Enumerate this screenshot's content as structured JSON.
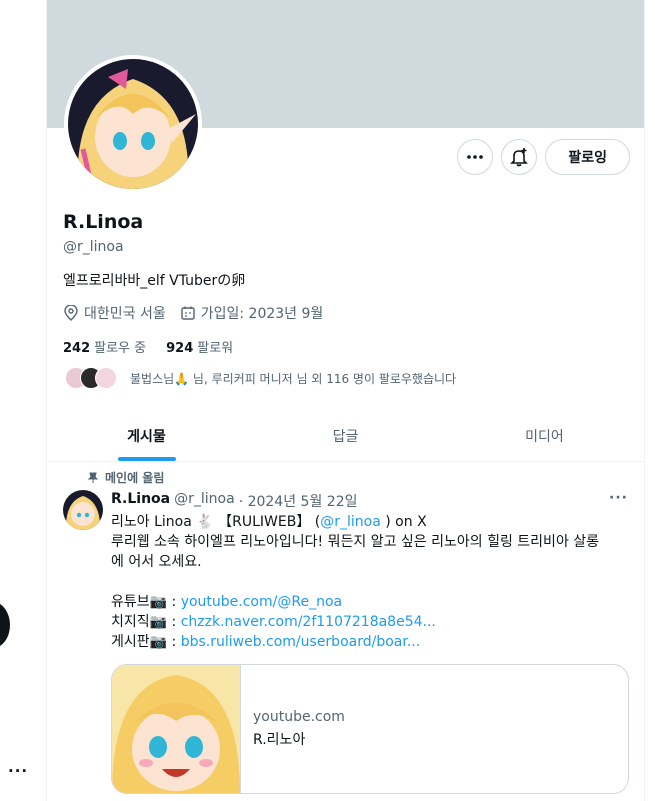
{
  "profile": {
    "name": "R.Linoa",
    "handle": "@r_linoa",
    "bio": "엘프로리바바_elf VTuberの卵",
    "location": "대한민국 서울",
    "joined": "가입일: 2023년 9월",
    "following_count": "242",
    "following_label": "팔로우 중",
    "followers_count": "924",
    "followers_label": "팔로워",
    "followed_by": "불법스님🙏 님, 루리커피 머니저 님 외 116 명이 팔로우했습니다",
    "follow_button": "팔로잉"
  },
  "tabs": [
    {
      "label": "게시물"
    },
    {
      "label": "답글"
    },
    {
      "label": "미디어"
    }
  ],
  "tweet": {
    "pinned_label": "메인에 올림",
    "author": "R.Linoa",
    "handle": "@r_linoa",
    "date": "· 2024년 5월 22일",
    "line1_a": "리노아 Linoa 🐇 【RULIWEB】 (",
    "line1_link": "@r_linoa",
    "line1_b": " ) on X",
    "line2": "루리웹 소속 하이엘프 리노아입니다! 뭐든지 알고 싶은 리노아의 힐링 트리비아 살롱",
    "line3": "에 어서 오세요.",
    "yt_label": "유튜브📷 : ",
    "yt_link": "youtube.com/@Re_noa",
    "chz_label": "치지직📷 : ",
    "chz_link": "chzzk.naver.com/2f1107218a8e54...",
    "board_label": "게시판📷 : ",
    "board_link": "bbs.ruliweb.com/userboard/boar..."
  },
  "card": {
    "domain": "youtube.com",
    "title": "R.리노아"
  },
  "sidebar": {
    "more": "..."
  },
  "colors": {
    "accent": "#1d9bf0",
    "banner": "#cfd9de",
    "secondary_text": "#536471"
  }
}
